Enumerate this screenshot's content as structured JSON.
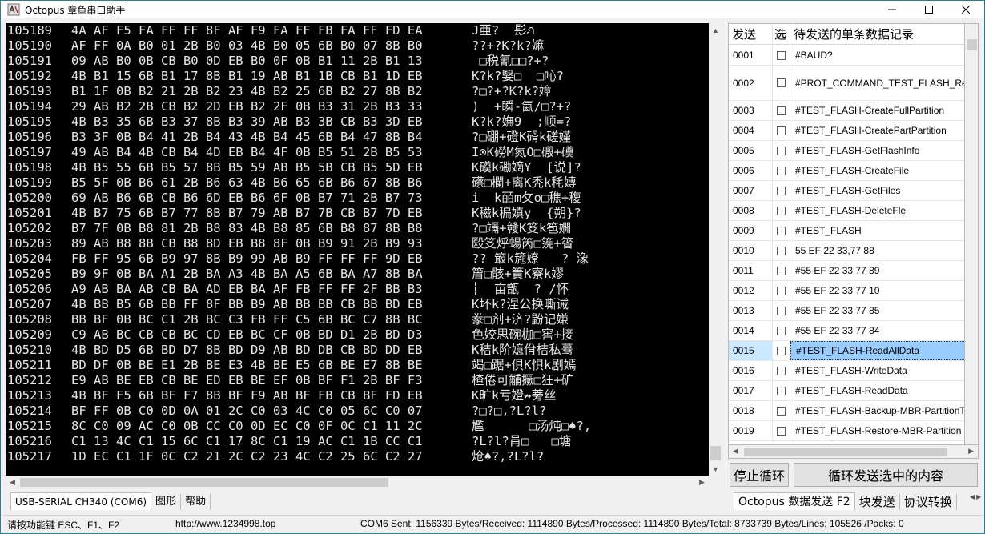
{
  "window": {
    "title": "Octopus 章鱼串口助手"
  },
  "terminal": {
    "lines": [
      {
        "addr": "105189",
        "hex": "4A AF F5 FA FF FF 8F AF F9 FA FF FB FA FF FD EA",
        "ascii": "J亜?  髟ภ"
      },
      {
        "addr": "105190",
        "hex": "AF FF 0A B0 01 2B B0 03 4B B0 05 6B B0 07 8B B0",
        "ascii": "??+?K?k?嫲"
      },
      {
        "addr": "105191",
        "hex": "09 AB B0 0B CB B0 0D EB B0 0F 0B B1 11 2B B1 13",
        "ascii": " □税氰□□?+?"
      },
      {
        "addr": "105192",
        "hex": "4B B1 15 6B B1 17 8B B1 19 AB B1 1B CB B1 1D EB",
        "ascii": "K?k?嫛□  □吣?"
      },
      {
        "addr": "105193",
        "hex": "B1 1F 0B B2 21 2B B2 23 4B B2 25 6B B2 27 8B B2",
        "ascii": "?□?+?K?k?嫜"
      },
      {
        "addr": "105194",
        "hex": "29 AB B2 2B CB B2 2D EB B2 2F 0B B3 31 2B B3 33",
        "ascii": ")  +瞬-氤/□?+?"
      },
      {
        "addr": "105195",
        "hex": "4B B3 35 6B B3 37 8B B3 39 AB B3 3B CB B3 3D EB",
        "ascii": "K?k?嫵9  ;顺=?"
      },
      {
        "addr": "105196",
        "hex": "B3 3F 0B B4 41 2B B4 43 4B B4 45 6B B4 47 8B B4",
        "ascii": "?□硼+磴K磆k磋嫤"
      },
      {
        "addr": "105197",
        "hex": "49 AB B4 4B CB B4 4D EB B4 4F 0B B5 51 2B B5 53",
        "ascii": "I⊙K磱M氮O□磤+磸"
      },
      {
        "addr": "105198",
        "hex": "4B B5 55 6B B5 57 8B B5 59 AB B5 5B CB B5 5D EB",
        "ascii": "K磸k磡嫡Y  [说]?"
      },
      {
        "addr": "105199",
        "hex": "B5 5F 0B B6 61 2B B6 63 4B B6 65 6B B6 67 8B B6",
        "ascii": "礤□欄+离K秃k秏嫥"
      },
      {
        "addr": "105200",
        "hex": "69 AB B6 6B CB B6 6D EB B6 6F 0B B7 71 2B B7 73",
        "ascii": "i  k皕m攵o□穛+稪"
      },
      {
        "addr": "105201",
        "hex": "4B B7 75 6B B7 77 8B B7 79 AB B7 7B CB B7 7D EB",
        "ascii": "K稵k稨嫃y  {朔}?"
      },
      {
        "addr": "105202",
        "hex": "B7 7F 0B B8 81 2B B8 83 4B B8 85 6B B8 87 8B B8",
        "ascii": "?□竵+竷K笅k笣嫺"
      },
      {
        "addr": "105203",
        "hex": "89 AB B8 8B CB B8 8D EB B8 8F 0B B9 91 2B B9 93",
        "ascii": "殹笅烀蝪笍□箲+箵"
      },
      {
        "addr": "105204",
        "hex": "FB FF 95 6B B9 97 8B B9 99 AB B9 FF FF FF 9D EB",
        "ascii": "?? 箃k箷嫽   ? 潒"
      },
      {
        "addr": "105205",
        "hex": "B9 9F 0B BA A1 2B BA A3 4B BA A5 6B BA A7 8B BA",
        "ascii": "篃□骸+篢K寮k嫪"
      },
      {
        "addr": "105206",
        "hex": "A9 AB BA AB CB BA AD EB BA AF FB FF FF 2F BB B3",
        "ascii": "┆  亩甑  ? /怀"
      },
      {
        "addr": "105207",
        "hex": "4B BB B5 6B BB FF 8F BB B9 AB BB BB CB BB BD EB",
        "ascii": "K坏k?涅公换嘶诫"
      },
      {
        "addr": "105208",
        "hex": "BB BF 0B BC C1 2B BC C3 FB FF C5 6B BC C7 8B BC",
        "ascii": "豢□剂+济?鼢记嫌"
      },
      {
        "addr": "105209",
        "hex": "C9 AB BC CB CB BC CD EB BC CF 0B BD D1 2B BD D3",
        "ascii": "色姣思碗枷□窖+接"
      },
      {
        "addr": "105210",
        "hex": "4B BD D5 6B BD D7 8B BD D9 AB BD DB CB BD DD EB",
        "ascii": "K秸k阶嬑佾桔私蓦"
      },
      {
        "addr": "105211",
        "hex": "BD DF 0B BE E1 2B BE E3 4B BE E5 6B BE E7 8B BE",
        "ascii": "竭□踞+俱K惧k剧嫣"
      },
      {
        "addr": "105212",
        "hex": "E9 AB BE EB CB BE ED EB BE EF 0B BF F1 2B BF F3",
        "ascii": "楂倦可黼撅□狂+矿"
      },
      {
        "addr": "105213",
        "hex": "4B BF F5 6B BF F7 8B BF F9 AB BF FB CB BF FD EB",
        "ascii": "K旷k亏嬁↛蒡丝"
      },
      {
        "addr": "105214",
        "hex": "BF FF 0B C0 0D 0A 01 2C C0 03 4C C0 05 6C C0 07",
        "ascii": "?□?□,?L?l?"
      },
      {
        "addr": "105215",
        "hex": "8C C0 09 AC C0 0B CC C0 0D EC C0 0F 0C C1 11 2C",
        "ascii": "尷      □汤炖□♠?,"
      },
      {
        "addr": "105216",
        "hex": "C1 13 4C C1 15 6C C1 17 8C C1 19 AC C1 1B CC C1",
        "ascii": "?L?l?肙□   □塘"
      },
      {
        "addr": "105217",
        "hex": "1D EC C1 1F 0C C2 21 2C C2 23 4C C2 25 6C C2 27",
        "ascii": "炝♠?,?L?l?"
      }
    ]
  },
  "left_tabs": [
    "USB-SERIAL CH340 (COM6)",
    "图形",
    "帮助"
  ],
  "list": {
    "headers": {
      "send": "发送",
      "select": "选",
      "record": "待发送的单条数据记录"
    },
    "rows": [
      {
        "idx": "0001",
        "text": "#BAUD?",
        "checked": false,
        "selected": false
      },
      {
        "idx": "0002",
        "text": "#PROT_COMMAND_TEST_FLASH_Rea",
        "checked": false,
        "selected": false
      },
      {
        "idx": "0003",
        "text": "#TEST_FLASH-CreateFullPartition",
        "checked": false,
        "selected": false
      },
      {
        "idx": "0004",
        "text": "#TEST_FLASH-CreatePartPartition",
        "checked": false,
        "selected": false
      },
      {
        "idx": "0005",
        "text": "#TEST_FLASH-GetFlashInfo",
        "checked": false,
        "selected": false
      },
      {
        "idx": "0006",
        "text": "#TEST_FLASH-CreateFile",
        "checked": false,
        "selected": false
      },
      {
        "idx": "0007",
        "text": "#TEST_FLASH-GetFiles",
        "checked": false,
        "selected": false
      },
      {
        "idx": "0008",
        "text": "#TEST_FLASH-DeleteFle",
        "checked": false,
        "selected": false
      },
      {
        "idx": "0009",
        "text": "#TEST_FLASH",
        "checked": false,
        "selected": false
      },
      {
        "idx": "0010",
        "text": "55 EF 22 33,77 88",
        "checked": false,
        "selected": false
      },
      {
        "idx": "0011",
        "text": "#55 EF 22 33 77 89",
        "checked": false,
        "selected": false
      },
      {
        "idx": "0012",
        "text": "#55 EF 22 33 77 10",
        "checked": false,
        "selected": false
      },
      {
        "idx": "0013",
        "text": "#55 EF 22 33 77 85",
        "checked": false,
        "selected": false
      },
      {
        "idx": "0014",
        "text": "#55 EF 22 33 77 84",
        "checked": false,
        "selected": false
      },
      {
        "idx": "0015",
        "text": "#TEST_FLASH-ReadAllData",
        "checked": false,
        "selected": true
      },
      {
        "idx": "0016",
        "text": "#TEST_FLASH-WriteData",
        "checked": false,
        "selected": false
      },
      {
        "idx": "0017",
        "text": "#TEST_FLASH-ReadData",
        "checked": false,
        "selected": false
      },
      {
        "idx": "0018",
        "text": "#TEST_FLASH-Backup-MBR-PartitionT",
        "checked": false,
        "selected": false
      },
      {
        "idx": "0019",
        "text": "#TEST_FLASH-Restore-MBR-Partition",
        "checked": false,
        "selected": false
      }
    ]
  },
  "buttons": {
    "stop_loop": "停止循环",
    "loop_send": "循环发送选中的内容"
  },
  "right_tabs": [
    "Octopus 数据发送 F2",
    "块发送",
    "协议转换"
  ],
  "status": {
    "shortcut": "请按功能键 ESC、F1、F2",
    "url": "http://www.1234998.top",
    "stats": "COM6 Sent: 1156339 Bytes/Received: 1114890 Bytes/Processed: 1114890 Bytes/Total: 8733739 Bytes/Lines: 105526 /Packs: 0"
  },
  "icons": {
    "app": "octopus-app-icon",
    "minimize": "minimize-icon",
    "maximize": "maximize-icon",
    "close": "close-icon"
  },
  "colors": {
    "terminal_bg": "#000000",
    "terminal_text": "#e6e6e6",
    "selection": "#99ccff",
    "window_border": "#2b7f93"
  }
}
